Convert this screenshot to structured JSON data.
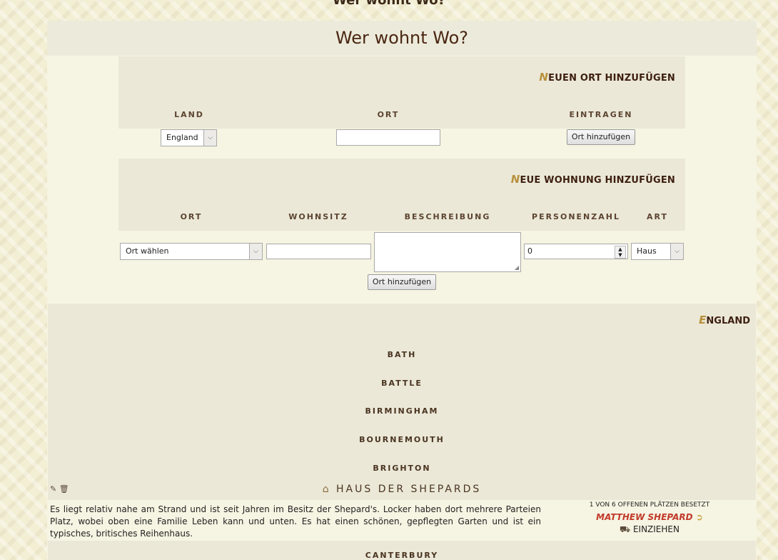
{
  "header": {
    "cut_title": "Wer wohnt Wo?",
    "title": "Wer wohnt Wo?"
  },
  "new_place": {
    "title_first": "N",
    "title_rest": "EUEN ORT HINZUFÜGEN",
    "col_land": "LAND",
    "col_ort": "ORT",
    "col_eintragen": "EINTRAGEN",
    "land_value": "England",
    "ort_value": "",
    "button": "Ort hinzufügen"
  },
  "new_home": {
    "title_first": "N",
    "title_rest": "EUE WOHNUNG HINZUFÜGEN",
    "col_ort": "ORT",
    "col_wohnsitz": "WOHNSITZ",
    "col_beschreibung": "BESCHREIBUNG",
    "col_personenzahl": "PERSONENZAHL",
    "col_art": "ART",
    "ort_select": "Ort wählen",
    "wohnsitz_value": "",
    "beschreibung_value": "",
    "personenzahl": "0",
    "art_select": "Haus",
    "button": "Ort hinzufügen"
  },
  "country": {
    "name_first": "E",
    "name_rest": "NGLAND",
    "cities": [
      "BATH",
      "BATTLE",
      "BIRMINGHAM",
      "BOURNEMOUTH",
      "BRIGHTON"
    ],
    "next_city": "CANTERBURY"
  },
  "house": {
    "title": "HAUS DER SHEPARDS",
    "description": "Es liegt relativ nahe am Strand und ist seit Jahren im Besitz der Shepard's. Locker haben dort mehrere Parteien Platz, wobei oben eine Familie Leben kann und unten. Es hat einen schönen, gepflegten Garten und ist ein typisches, britisches Reihenhaus.",
    "occupancy": "1 VON 6 OFFENEN PLÄTZEN BESETZT",
    "resident": "MATTHEW SHEPARD",
    "move_in": "EINZIEHEN",
    "icons": [
      "edit-icon",
      "trash-icon",
      "home-icon",
      "logout-icon",
      "truck-icon"
    ]
  },
  "colors": {
    "background": "#f3efd4",
    "panel": "#f6f4e2",
    "box": "#ebe8d8",
    "accent": "#b9913c",
    "heading": "#4a2712",
    "resident": "#c23a2a"
  }
}
